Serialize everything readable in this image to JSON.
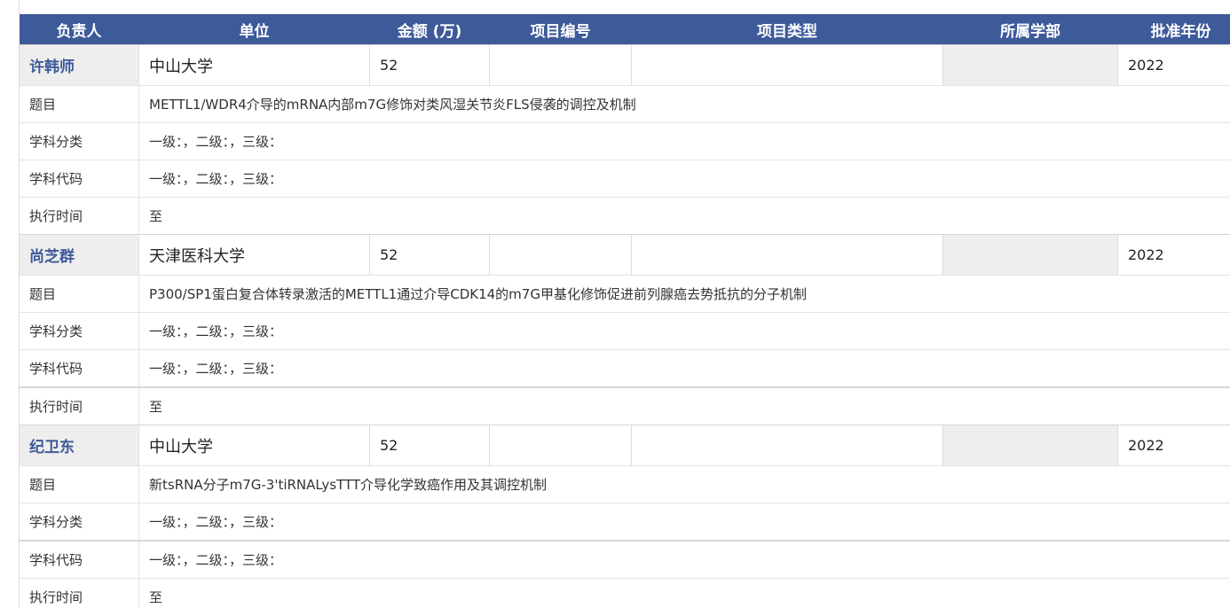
{
  "header": {
    "person": "负责人",
    "unit": "单位",
    "amount": "金额 (万)",
    "project_no": "项目编号",
    "project_type": "项目类型",
    "department": "所属学部",
    "year": "批准年份"
  },
  "records": [
    {
      "person": "许韩师",
      "unit": "中山大学",
      "amount": "52",
      "project_no": "",
      "project_type": "",
      "department": "",
      "year": "2022",
      "title_label": "题目",
      "title": "METTL1/WDR4介导的mRNA内部m7G修饰对类风湿关节炎FLS侵袭的调控及机制",
      "category_label": "学科分类",
      "category": "一级：，二级：，三级：",
      "code_label": "学科代码",
      "code": "一级：，二级：，三级：",
      "time_label": "执行时间",
      "time": "至"
    },
    {
      "person": "尚芝群",
      "unit": "天津医科大学",
      "amount": "52",
      "project_no": "",
      "project_type": "",
      "department": "",
      "year": "2022",
      "title_label": "题目",
      "title": "P300/SP1蛋白复合体转录激活的METTL1通过介导CDK14的m7G甲基化修饰促进前列腺癌去势抵抗的分子机制",
      "category_label": "学科分类",
      "category": "一级：，二级：，三级：",
      "code_label": "学科代码",
      "code": "一级：，二级：，三级：",
      "time_label": "执行时间",
      "time": "至"
    },
    {
      "person": "纪卫东",
      "unit": "中山大学",
      "amount": "52",
      "project_no": "",
      "project_type": "",
      "department": "",
      "year": "2022",
      "title_label": "题目",
      "title": "新tsRNA分子m7G-3'tiRNALysTTT介导化学致癌作用及其调控机制",
      "category_label": "学科分类",
      "category": "一级：，二级：，三级：",
      "code_label": "学科代码",
      "code": "一级：，二级：，三级：",
      "time_label": "执行时间",
      "time": "至"
    }
  ]
}
